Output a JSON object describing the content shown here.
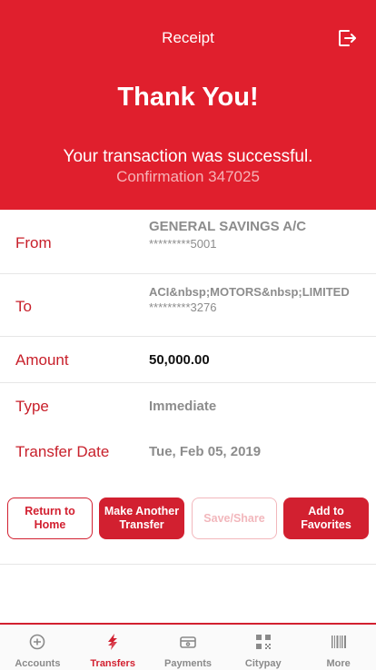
{
  "header": {
    "title": "Receipt",
    "heading": "Thank You!",
    "message": "Your transaction was successful.",
    "confirmation": "Confirmation 347025",
    "icon": "logout-icon"
  },
  "details": {
    "from": {
      "label": "From",
      "name": "GENERAL SAVINGS A/C",
      "account": "*********5001"
    },
    "to": {
      "label": "To",
      "name": "ACI&nbsp;MOTORS&nbsp;LIMITED",
      "account": "*********3276"
    },
    "amount": {
      "label": "Amount",
      "value": "50,000.00"
    },
    "type": {
      "label": "Type",
      "value": "Immediate"
    },
    "date": {
      "label": "Transfer Date",
      "value": "Tue, Feb 05, 2019"
    }
  },
  "actions": {
    "return_home": "Return to Home",
    "make_another": "Make Another Transfer",
    "save_share": "Save/Share",
    "add_favorites": "Add to Favorites"
  },
  "tabs": [
    {
      "label": "Accounts",
      "icon": "accounts-icon"
    },
    {
      "label": "Transfers",
      "icon": "transfers-icon",
      "active": true
    },
    {
      "label": "Payments",
      "icon": "payments-icon"
    },
    {
      "label": "Citypay",
      "icon": "qr-code-icon"
    },
    {
      "label": "More",
      "icon": "barcode-icon"
    }
  ],
  "colors": {
    "brand": "#e01f2d",
    "accent": "#d22030",
    "muted": "#8c8c8c"
  }
}
